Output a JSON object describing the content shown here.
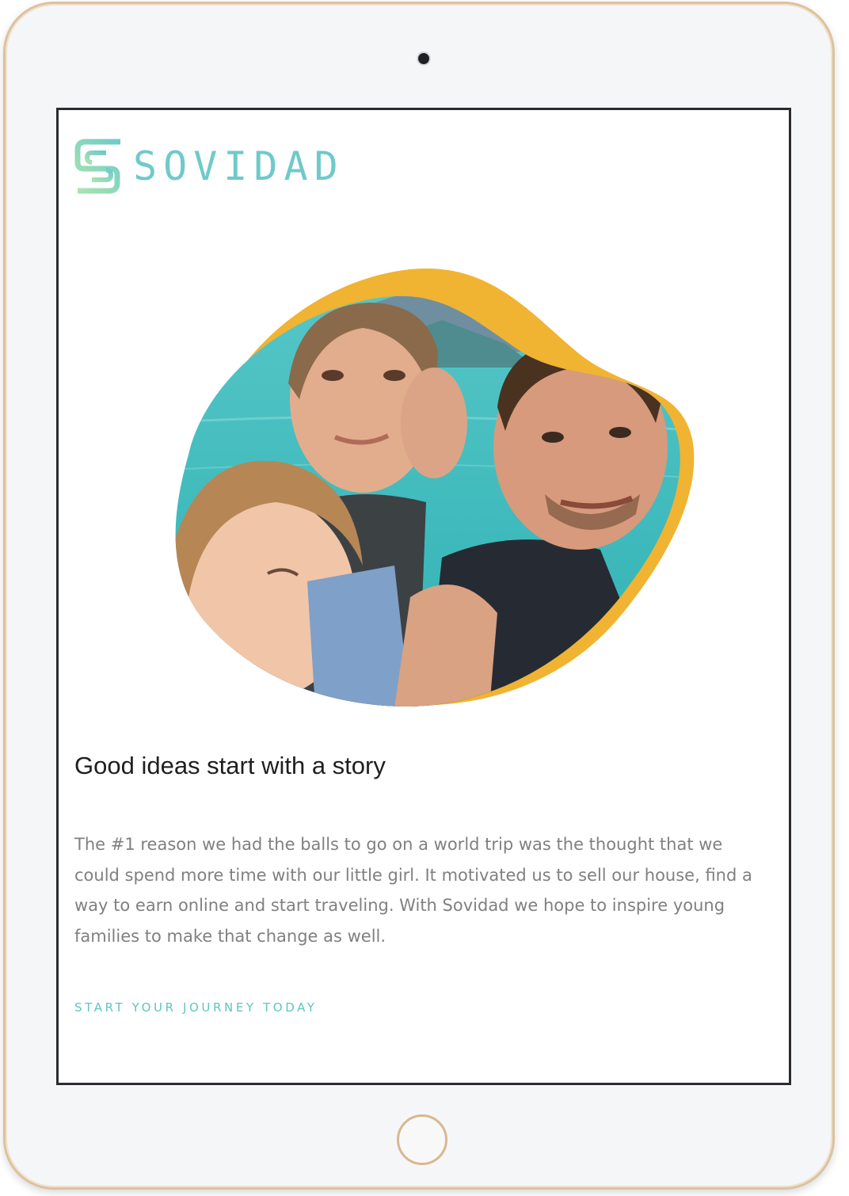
{
  "brand": {
    "name": "SOVIDAD",
    "logo_colors": [
      "#9fe0b4",
      "#6fcac9"
    ],
    "accent": "#6fcac9"
  },
  "hero": {
    "image_description_icon": "family-selfie-photo",
    "blob_color": "#f1b332",
    "water_color": "#3fc3c3"
  },
  "content": {
    "headline": "Good ideas start with a story",
    "body": "The #1 reason we had the balls to go on a world trip was the thought that we could spend more time with our little girl. It motivated us to sell our house, find a way to earn online and start traveling. With Sovidad we hope to inspire young families to make that change as well.",
    "cta_label": "START YOUR JOURNEY TODAY"
  },
  "device": {
    "frame_color": "#dcc29f"
  }
}
